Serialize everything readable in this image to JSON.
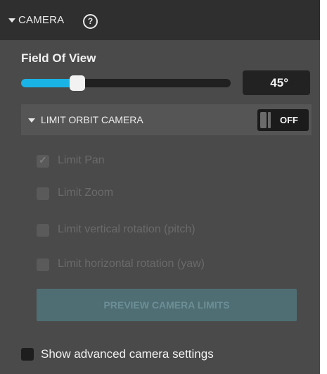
{
  "header": {
    "title": "CAMERA",
    "help_icon": "question-circle-icon",
    "collapse_icon": "caret-down-icon"
  },
  "field_of_view": {
    "label": "Field Of View",
    "value_text": "45°",
    "slider_fraction": 0.27
  },
  "limit_orbit": {
    "label": "LIMIT ORBIT CAMERA",
    "toggle_text": "OFF"
  },
  "options": [
    {
      "label": "Limit Pan",
      "checked": true
    },
    {
      "label": "Limit Zoom",
      "checked": false
    },
    {
      "label": "Limit vertical rotation (pitch)",
      "checked": false
    },
    {
      "label": "Limit horizontal rotation (yaw)",
      "checked": false
    }
  ],
  "preview_button": {
    "label": "PREVIEW CAMERA LIMITS"
  },
  "advanced": {
    "label": "Show advanced camera settings",
    "checked": false
  },
  "colors": {
    "accent": "#1ab3e6",
    "panel_bg": "#4a4a4a",
    "header_bg": "#2f2f2f"
  }
}
